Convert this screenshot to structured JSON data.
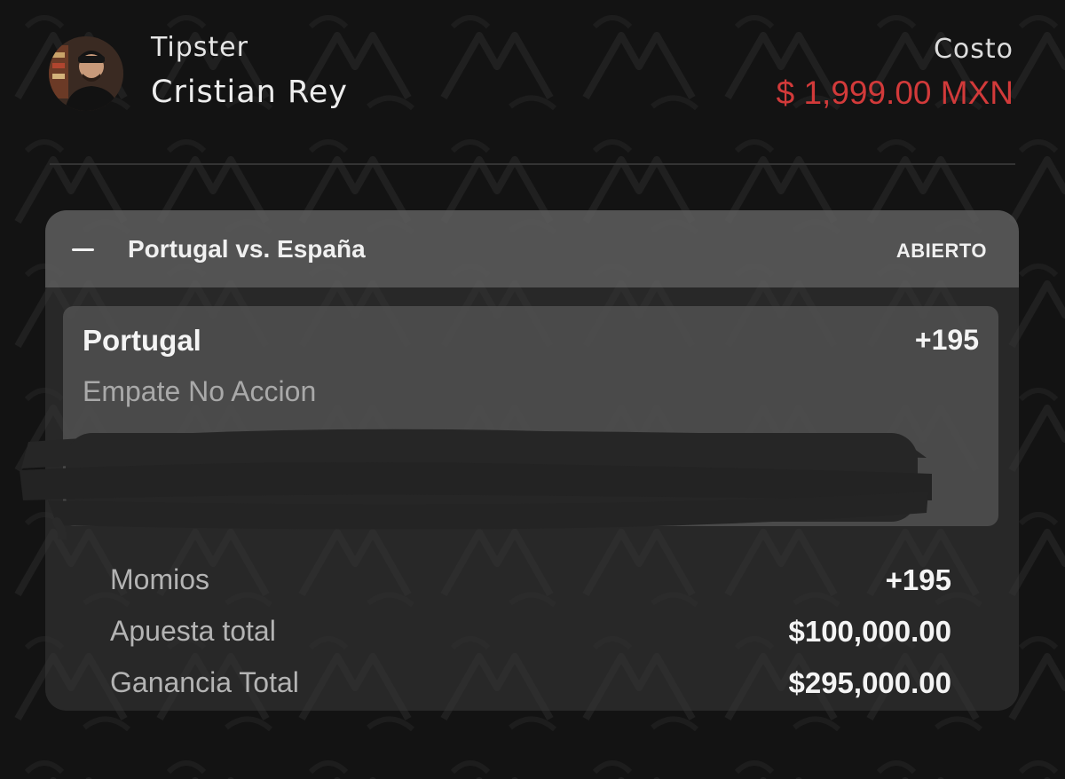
{
  "header": {
    "tipster_label": "Tipster",
    "tipster_name": "Cristian Rey",
    "cost_label": "Costo",
    "cost_value": "$ 1,999.00 MXN"
  },
  "bet": {
    "match_title": "Portugal vs. España",
    "status": "ABIERTO",
    "pick": {
      "team": "Portugal",
      "odds": "+195",
      "market": "Empate No Accion"
    },
    "summary": [
      {
        "label": "Momios",
        "value": "+195"
      },
      {
        "label": "Apuesta total",
        "value": "$100,000.00"
      },
      {
        "label": "Ganancia Total",
        "value": "$295,000.00"
      }
    ]
  },
  "colors": {
    "background": "#131313",
    "cost_accent": "#d23a3a",
    "card": "#343434",
    "header_bar": "#767676"
  },
  "icons": {
    "avatar": "user-photo",
    "collapse": "minus-icon"
  }
}
